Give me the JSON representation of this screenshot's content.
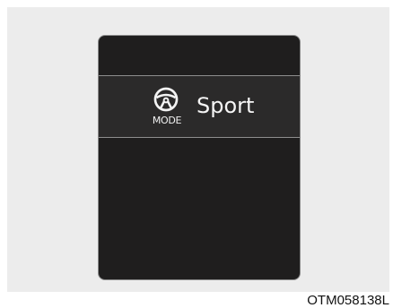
{
  "display": {
    "icon": "steering-wheel-icon",
    "mode_caption": "MODE",
    "mode_value": "Sport"
  },
  "figure_code": "OTM058138L"
}
